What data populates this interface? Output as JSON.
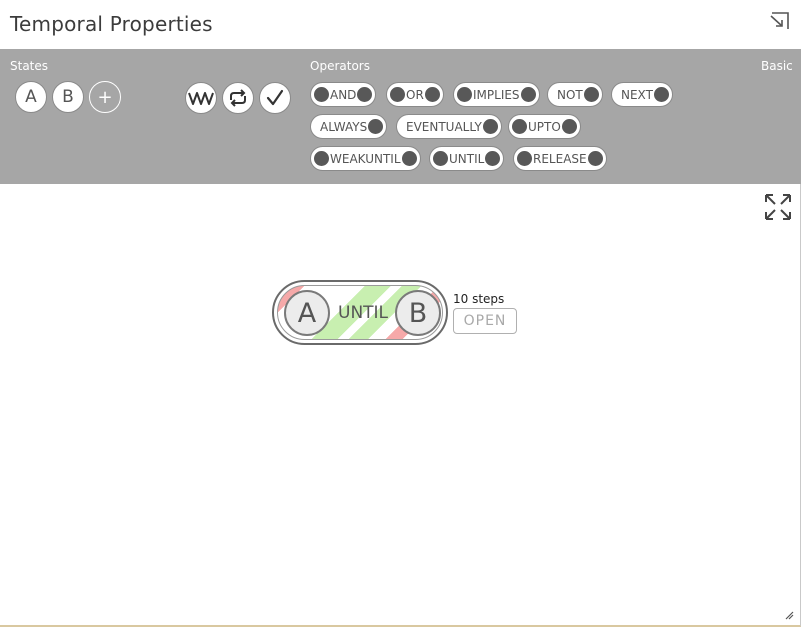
{
  "window": {
    "title": "Temporal Properties",
    "popout_icon": "popout-arrow-icon"
  },
  "toolbar": {
    "states_label": "States",
    "operators_label": "Operators",
    "mode_label": "Basic",
    "states": [
      "A",
      "B"
    ],
    "add_state": "+",
    "tools": [
      "waveform-icon",
      "loop-icon",
      "check-icon"
    ],
    "operators": {
      "and": "AND",
      "or": "OR",
      "implies": "IMPLIES",
      "not": "NOT",
      "next": "NEXT",
      "always": "ALWAYS",
      "eventually": "EVENTUALLY",
      "upto": "UPTO",
      "weakuntil": "WEAKUNTIL",
      "until": "UNTIL",
      "release": "RELEASE"
    }
  },
  "canvas": {
    "expression": {
      "left": "A",
      "operator": "UNTIL",
      "right": "B"
    },
    "steps_text": "10 steps",
    "open_label": "OPEN",
    "colors": {
      "fail": "#f6a9a9",
      "pass": "#c8efb0"
    }
  }
}
